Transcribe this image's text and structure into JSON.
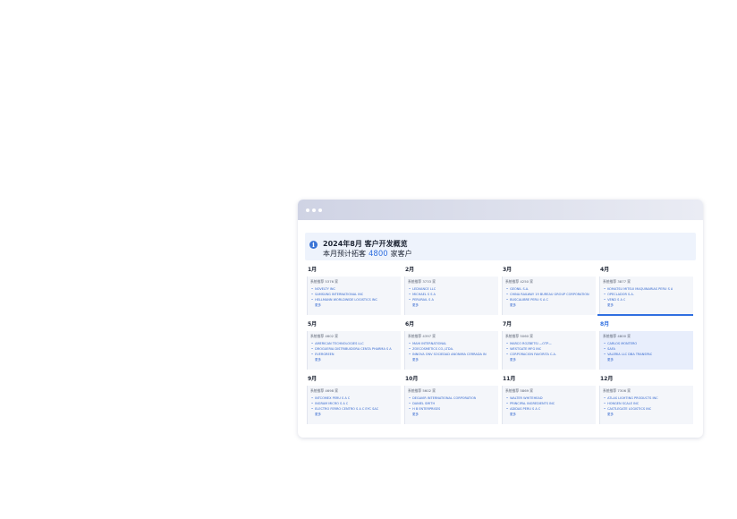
{
  "overview": {
    "title": "2024年8月 客户开发概览",
    "subtitle_prefix": "本月预计拓客",
    "subtitle_count": "4800",
    "subtitle_suffix": "家客户"
  },
  "more_label": "更多",
  "months": [
    {
      "label": "1月",
      "rec": "系统推荐 5376 家",
      "companies": [
        "NOVELTY INC",
        "SAMSUNG INTERNATIONAL INC",
        "HELLMANN WORLDWIDE LOGISTICS INC"
      ]
    },
    {
      "label": "2月",
      "rec": "系统推荐 3733 家",
      "companies": [
        "LEDVANCE LLC",
        "MICHAEL S S A",
        "PERURAIL S A"
      ]
    },
    {
      "label": "3月",
      "rec": "系统推荐 4250 家",
      "companies": [
        "GEONIL S.A.",
        "CHINA RAILWAY 19 BUREAU GROUP CORPORATION",
        "BUSCALIBRE PERU S A C"
      ]
    },
    {
      "label": "4月",
      "rec": "系统推荐 3877 家",
      "companies": [
        "KOMATSU MITSUI MAQUINARIAS PERU S A",
        "OPECLADOR S.A.",
        "VEND S A C"
      ]
    },
    {
      "label": "5月",
      "rec": "系统推荐 4602 家",
      "companies": [
        "AMERICAN TECHNOLOGIES LLC",
        "DROGUERIA DISTRIBUIDORA CENTA PHARMA S A",
        "EVERGREEN"
      ]
    },
    {
      "label": "6月",
      "rec": "系统推荐 4397 家",
      "companies": [
        "MAHI INTERNATIONAL",
        "ZOECOSMETICS CO.,LTDA.",
        "INNOVA ONV SOCIEDAD ANONIMA CERRADA IN"
      ]
    },
    {
      "label": "7月",
      "rec": "系统推荐 5060 家",
      "companies": [
        "MARCO ROZBETSI —OTP—",
        "WESTGATE MFG INC",
        "CORPORACION FAVORITA C.A."
      ]
    },
    {
      "label": "8月",
      "rec": "系统推荐 4800 家",
      "companies": [
        "CARLOS MONTERO",
        "SAFA",
        "VALERIA LLC DBA TRANSPAC"
      ],
      "active": true
    },
    {
      "label": "9月",
      "rec": "系统推荐 4698 家",
      "companies": [
        "INTCOMEX PERU S A C",
        "INGRAM MICRO S A C",
        "ELECTRO FERRO CENTRO S A C EYC SAC"
      ]
    },
    {
      "label": "10月",
      "rec": "系统推荐 5602 家",
      "companies": [
        "DEGAVIR INTERNATIONAL CORPORATION",
        "DANIEL SMITH",
        "H B ENTERPRISES"
      ]
    },
    {
      "label": "11月",
      "rec": "系统推荐 5869 家",
      "companies": [
        "WALTER WHITEHEAD",
        "PRINCIPAL INGREDIENTS INC",
        "ADIDAS PERU S A C"
      ]
    },
    {
      "label": "12月",
      "rec": "系统推荐 7306 家",
      "companies": [
        "ATLAS LIGHTING PRODUCTS INC",
        "HONGEN SCALE INC",
        "CASTLEGATE LOGISTICS INC"
      ]
    }
  ]
}
